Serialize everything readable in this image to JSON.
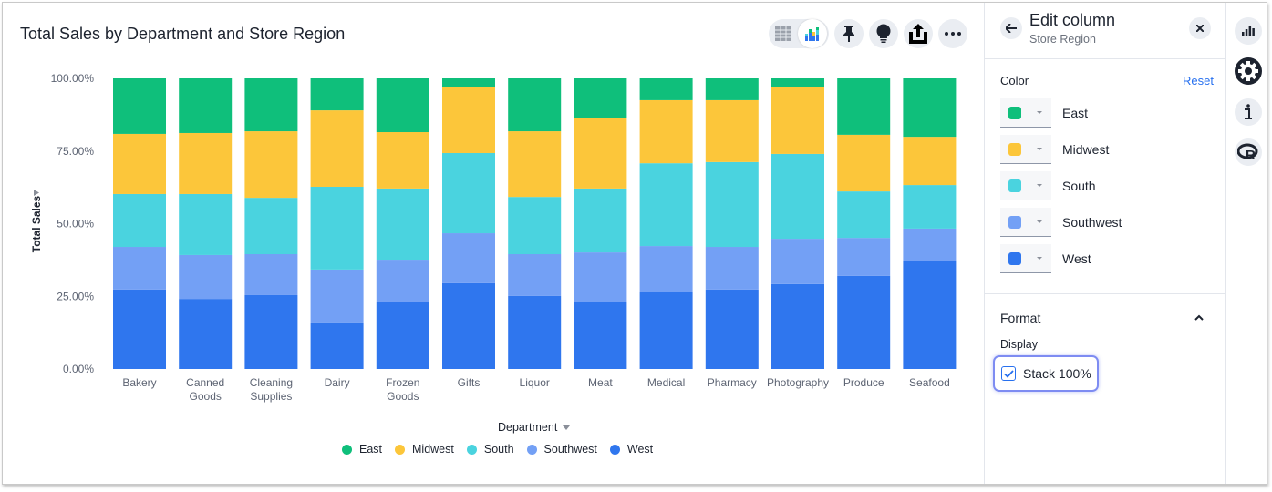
{
  "chart_title": "Total Sales by Department and Store Region",
  "toolbar": {
    "table_view_icon": "table-icon",
    "chart_view_icon": "chart-icon",
    "pin_icon": "pin-icon",
    "insight_icon": "lightbulb-icon",
    "share_icon": "share-icon",
    "more_icon": "more-icon",
    "more_label": "•••"
  },
  "chart_data": {
    "type": "bar",
    "stacked": true,
    "stack_mode": "percent",
    "title": "Total Sales by Department and Store Region",
    "xlabel": "Department",
    "ylabel": "Total Sales",
    "ylim": [
      0,
      100
    ],
    "yticks": [
      "0.00%",
      "25.00%",
      "50.00%",
      "75.00%",
      "100.00%"
    ],
    "grid": false,
    "legend_position": "bottom",
    "categories": [
      "Bakery",
      "Canned Goods",
      "Cleaning Supplies",
      "Dairy",
      "Frozen Goods",
      "Gifts",
      "Liquor",
      "Meat",
      "Medical",
      "Pharmacy",
      "Photography",
      "Produce",
      "Seafood"
    ],
    "category_lines": [
      [
        "Bakery"
      ],
      [
        "Canned",
        "Goods"
      ],
      [
        "Cleaning",
        "Supplies"
      ],
      [
        "Dairy"
      ],
      [
        "Frozen",
        "Goods"
      ],
      [
        "Gifts"
      ],
      [
        "Liquor"
      ],
      [
        "Meat"
      ],
      [
        "Medical"
      ],
      [
        "Pharmacy"
      ],
      [
        "Photography"
      ],
      [
        "Produce"
      ],
      [
        "Seafood"
      ]
    ],
    "series": [
      {
        "name": "West",
        "color": "#2f76ee",
        "values": [
          27.3,
          24.1,
          25.4,
          16.0,
          23.2,
          29.5,
          25.1,
          22.9,
          26.6,
          27.3,
          29.2,
          32.0,
          37.3
        ]
      },
      {
        "name": "Southwest",
        "color": "#73a0f5",
        "values": [
          14.7,
          15.1,
          14.1,
          18.2,
          14.4,
          17.2,
          14.4,
          17.2,
          15.7,
          14.7,
          15.6,
          13.1,
          11.0
        ]
      },
      {
        "name": "South",
        "color": "#4ad3df",
        "values": [
          18.2,
          21.0,
          19.4,
          28.5,
          24.5,
          27.6,
          19.7,
          22.0,
          28.5,
          29.2,
          29.2,
          16.0,
          15.0
        ]
      },
      {
        "name": "Midwest",
        "color": "#fcc63a",
        "values": [
          20.7,
          21.0,
          22.9,
          26.3,
          19.4,
          22.6,
          22.6,
          24.4,
          21.7,
          21.3,
          22.9,
          19.5,
          16.6
        ]
      },
      {
        "name": "East",
        "color": "#0fbf7b",
        "values": [
          19.1,
          18.8,
          18.2,
          11.0,
          18.5,
          3.1,
          18.2,
          13.5,
          7.5,
          7.5,
          3.1,
          19.4,
          20.1
        ]
      }
    ]
  },
  "legend": [
    {
      "name": "East",
      "color": "#0fbf7b"
    },
    {
      "name": "Midwest",
      "color": "#fcc63a"
    },
    {
      "name": "South",
      "color": "#4ad3df"
    },
    {
      "name": "Southwest",
      "color": "#73a0f5"
    },
    {
      "name": "West",
      "color": "#2f76ee"
    }
  ],
  "panel": {
    "title": "Edit column",
    "subtitle": "Store Region",
    "color_label": "Color",
    "reset_label": "Reset",
    "colors": [
      {
        "name": "East",
        "color": "#0fbf7b"
      },
      {
        "name": "Midwest",
        "color": "#fcc63a"
      },
      {
        "name": "South",
        "color": "#4ad3df"
      },
      {
        "name": "Southwest",
        "color": "#73a0f5"
      },
      {
        "name": "West",
        "color": "#2f76ee"
      }
    ],
    "format_label": "Format",
    "display_label": "Display",
    "stack_label": "Stack 100%",
    "stack_checked": true
  },
  "rail": {
    "items": [
      "chart-config-icon",
      "settings-icon",
      "info-icon",
      "r-analysis-icon"
    ],
    "active": "settings-icon"
  }
}
